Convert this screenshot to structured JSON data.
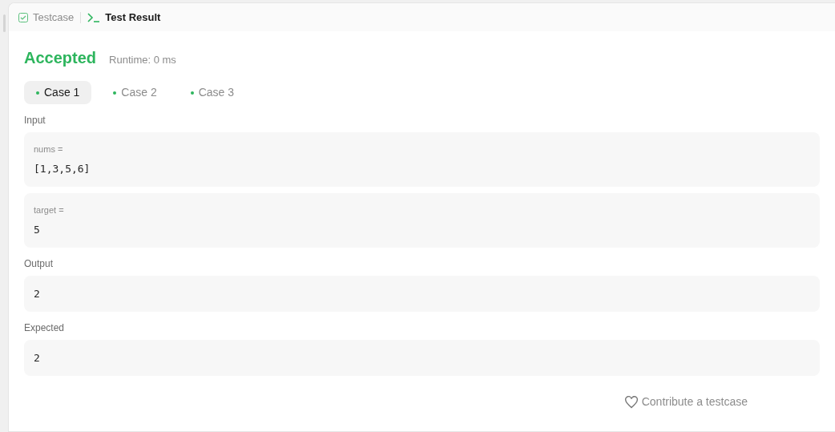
{
  "panel_tabs": [
    {
      "label": "Testcase",
      "kind": "checkbox",
      "selected": false
    },
    {
      "label": "Test Result",
      "kind": "terminal",
      "selected": true
    }
  ],
  "result": {
    "status": "Accepted",
    "runtime": "Runtime: 0 ms"
  },
  "cases": [
    {
      "label": "Case 1",
      "selected": true
    },
    {
      "label": "Case 2",
      "selected": false
    },
    {
      "label": "Case 3",
      "selected": false
    }
  ],
  "input": {
    "label": "Input",
    "params": [
      {
        "name": "nums =",
        "value": "[1,3,5,6]"
      },
      {
        "name": "target =",
        "value": "5"
      }
    ]
  },
  "output": {
    "label": "Output",
    "value": "2"
  },
  "expected": {
    "label": "Expected",
    "value": "2"
  },
  "contribute_link": "Contribute a testcase"
}
